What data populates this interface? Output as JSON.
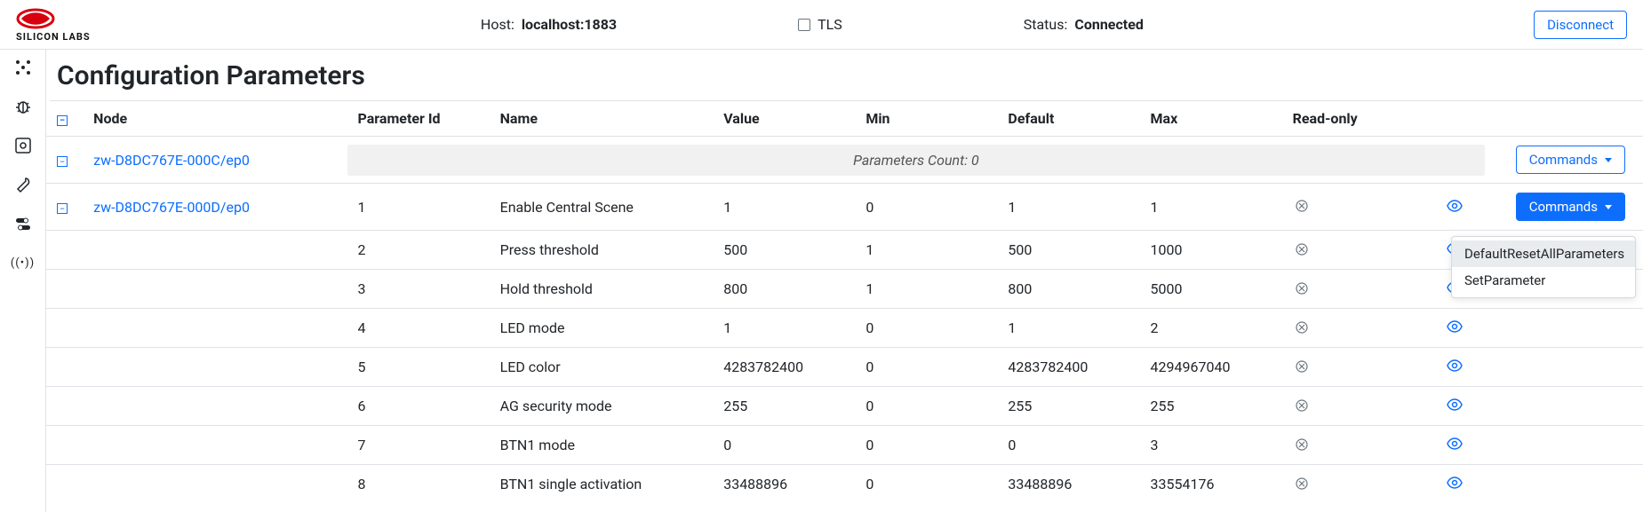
{
  "header": {
    "brand_top": "SILICON",
    "brand_sub": "SILICON LABS",
    "host_label": "Host:",
    "host_value": "localhost:1883",
    "tls_label": "TLS",
    "tls_checked": false,
    "status_label": "Status:",
    "status_value": "Connected",
    "disconnect_label": "Disconnect"
  },
  "sidebar": {
    "items": [
      {
        "name": "network-icon"
      },
      {
        "name": "bug-icon"
      },
      {
        "name": "gear-icon"
      },
      {
        "name": "wrench-icon"
      },
      {
        "name": "toggle-icon"
      },
      {
        "name": "signal-icon"
      }
    ]
  },
  "page": {
    "title": "Configuration Parameters"
  },
  "table": {
    "headers": {
      "node": "Node",
      "parameter_id": "Parameter Id",
      "name": "Name",
      "value": "Value",
      "min": "Min",
      "default": "Default",
      "max": "Max",
      "readonly": "Read-only"
    },
    "commands_label": "Commands",
    "params_count_label": "Parameters Count: 0",
    "nodes": [
      {
        "id": "zw-D8DC767E-000C/ep0",
        "expanded": true,
        "empty": true,
        "commands_variant": "outline"
      },
      {
        "id": "zw-D8DC767E-000D/ep0",
        "expanded": true,
        "empty": false,
        "commands_variant": "primary",
        "rows": [
          {
            "pid": "1",
            "name": "Enable Central Scene",
            "value": "1",
            "min": "0",
            "default": "1",
            "max": "1"
          },
          {
            "pid": "2",
            "name": "Press threshold",
            "value": "500",
            "min": "1",
            "default": "500",
            "max": "1000"
          },
          {
            "pid": "3",
            "name": "Hold threshold",
            "value": "800",
            "min": "1",
            "default": "800",
            "max": "5000"
          },
          {
            "pid": "4",
            "name": "LED mode",
            "value": "1",
            "min": "0",
            "default": "1",
            "max": "2"
          },
          {
            "pid": "5",
            "name": "LED color",
            "value": "4283782400",
            "min": "0",
            "default": "4283782400",
            "max": "4294967040"
          },
          {
            "pid": "6",
            "name": "AG security mode",
            "value": "255",
            "min": "0",
            "default": "255",
            "max": "255"
          },
          {
            "pid": "7",
            "name": "BTN1 mode",
            "value": "0",
            "min": "0",
            "default": "0",
            "max": "3"
          },
          {
            "pid": "8",
            "name": "BTN1 single activation",
            "value": "33488896",
            "min": "0",
            "default": "33488896",
            "max": "33554176"
          }
        ]
      }
    ]
  },
  "dropdown": {
    "items": [
      {
        "label": "DefaultResetAllParameters",
        "highlight": true
      },
      {
        "label": "SetParameter",
        "highlight": false
      }
    ]
  }
}
